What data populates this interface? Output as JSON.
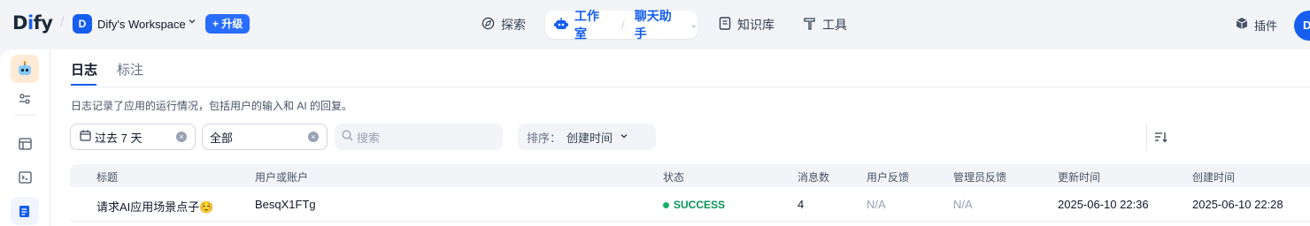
{
  "header": {
    "logo": {
      "prefix": "D",
      "i": "i",
      "suffix": "fy"
    },
    "workspace": {
      "initial": "D",
      "name": "Dify's Workspace"
    },
    "upgrade_label": "升级",
    "nav": {
      "explore": "探索",
      "studio": "工作室",
      "app_name": "聊天助手",
      "knowledge": "知识库",
      "tools": "工具",
      "plugins": "插件"
    },
    "user_initial": "D"
  },
  "page": {
    "tabs": [
      {
        "label": "日志",
        "active": true
      },
      {
        "label": "标注",
        "active": false
      }
    ],
    "description": "日志记录了应用的运行情况，包括用户的输入和 AI 的回复。"
  },
  "filters": {
    "period": "过去 7 天",
    "status": "全部",
    "search_placeholder": "搜索",
    "sort_label": "排序：",
    "sort_value": "创建时间"
  },
  "table": {
    "columns": [
      "标题",
      "用户或账户",
      "状态",
      "消息数",
      "用户反馈",
      "管理员反馈",
      "更新时间",
      "创建时间"
    ],
    "rows": [
      {
        "title": "请求AI应用场景点子☺️",
        "user": "BesqX1FTg",
        "status": "SUCCESS",
        "messages": "4",
        "user_feedback": "N/A",
        "admin_feedback": "N/A",
        "updated": "2025-06-10 22:36",
        "created": "2025-06-10 22:28"
      }
    ]
  },
  "colors": {
    "accent": "#155eef",
    "success": "#079455",
    "app_icon_bg": "#ffead5"
  }
}
